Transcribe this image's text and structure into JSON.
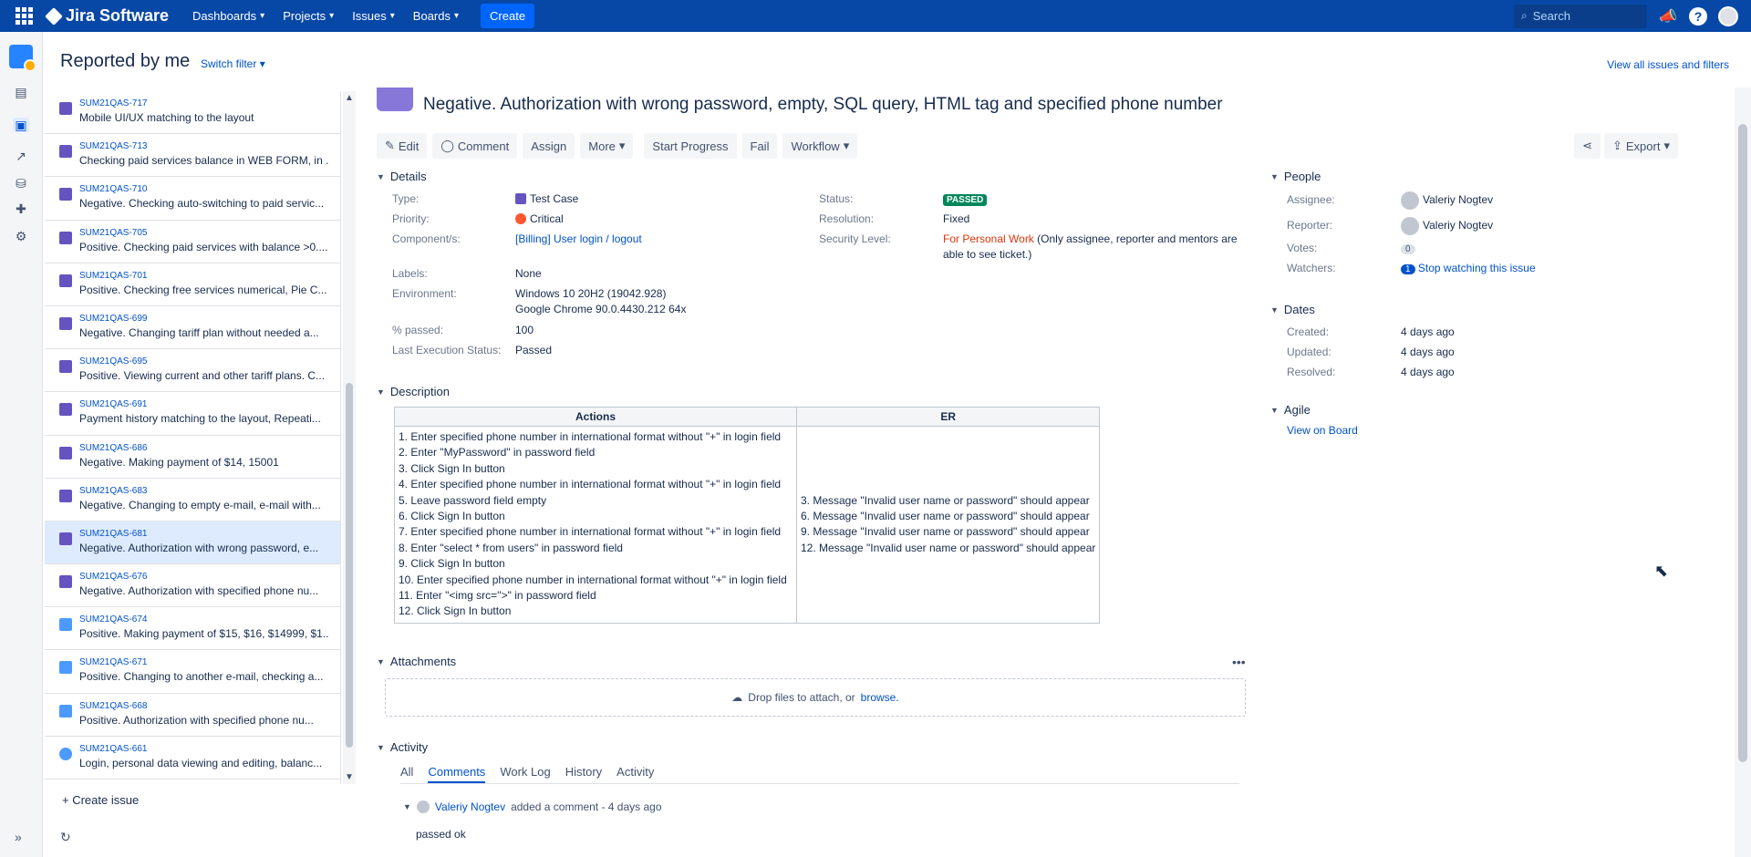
{
  "topnav": {
    "product": "Jira Software",
    "menu": [
      "Dashboards",
      "Projects",
      "Issues",
      "Boards"
    ],
    "create_label": "Create",
    "search_placeholder": "Search"
  },
  "header": {
    "title": "Reported by me",
    "switch_filter": "Switch filter",
    "view_all": "View all issues and filters"
  },
  "issues": [
    {
      "key": "SUM21QAS-717",
      "summary": "Mobile UI/UX matching to the layout",
      "type": "test"
    },
    {
      "key": "SUM21QAS-713",
      "summary": "Checking paid services balance in WEB FORM, in ...",
      "type": "test"
    },
    {
      "key": "SUM21QAS-710",
      "summary": "Negative. Checking auto-switching to paid servic...",
      "type": "test"
    },
    {
      "key": "SUM21QAS-705",
      "summary": "Positive. Checking paid services with balance >0....",
      "type": "test"
    },
    {
      "key": "SUM21QAS-701",
      "summary": "Positive. Checking free services numerical, Pie C...",
      "type": "test"
    },
    {
      "key": "SUM21QAS-699",
      "summary": "Negative. Changing tariff plan without needed a...",
      "type": "test"
    },
    {
      "key": "SUM21QAS-695",
      "summary": "Positive. Viewing current and other tariff plans. C...",
      "type": "test"
    },
    {
      "key": "SUM21QAS-691",
      "summary": "Payment history matching to the layout, Repeati...",
      "type": "test"
    },
    {
      "key": "SUM21QAS-686",
      "summary": "Negative. Making payment of $14, 15001",
      "type": "test"
    },
    {
      "key": "SUM21QAS-683",
      "summary": "Negative. Changing to empty e-mail, e-mail with...",
      "type": "test"
    },
    {
      "key": "SUM21QAS-681",
      "summary": "Negative. Authorization with wrong password, e...",
      "type": "test",
      "selected": true
    },
    {
      "key": "SUM21QAS-676",
      "summary": "Negative. Authorization with specified phone nu...",
      "type": "test"
    },
    {
      "key": "SUM21QAS-674",
      "summary": "Positive. Making payment of $15, $16, $14999, $1...",
      "type": "story"
    },
    {
      "key": "SUM21QAS-671",
      "summary": "Positive. Changing to another e-mail, checking a...",
      "type": "story"
    },
    {
      "key": "SUM21QAS-668",
      "summary": "Positive. Authorization with specified phone nu...",
      "type": "story"
    },
    {
      "key": "SUM21QAS-661",
      "summary": "Login, personal data viewing and editing, balanc...",
      "type": "epic"
    }
  ],
  "create_issue": "+ Create issue",
  "issue": {
    "title": "Negative. Authorization with wrong password, empty, SQL query, HTML tag and specified phone number",
    "toolbar": [
      "Edit",
      "Comment",
      "Assign",
      "More",
      "Start Progress",
      "Fail",
      "Workflow"
    ],
    "export_label": "Export",
    "details_heading": "Details",
    "fields": {
      "type_label": "Type:",
      "type": "Test Case",
      "priority_label": "Priority:",
      "priority": "Critical",
      "components_label": "Component/s:",
      "components": "[Billing] User login / logout",
      "labels_label": "Labels:",
      "labels": "None",
      "environment_label": "Environment:",
      "environment_1": "Windows 10 20H2 (19042.928)",
      "environment_2": "Google Chrome 90.0.4430.212 64x",
      "passed_label": "% passed:",
      "passed": "100",
      "last_exec_label": "Last Execution Status:",
      "last_exec": "Passed",
      "status_label": "Status:",
      "status": "PASSED",
      "resolution_label": "Resolution:",
      "resolution": "Fixed",
      "security_label": "Security Level:",
      "security_link": "For Personal Work",
      "security_note_1": "(Only assignee, reporter and mentors are",
      "security_note_2": "able to see ticket.)"
    },
    "description_heading": "Description",
    "table": {
      "headers": [
        "Actions",
        "ER"
      ],
      "actions": [
        "1. Enter specified phone number in international format without \"+\" in login field",
        "2. Enter \"MyPassword\" in password field",
        "3. Click Sign In button",
        "4. Enter specified phone number in international format without \"+\" in login field",
        "5. Leave password field empty",
        "6. Click Sign In button",
        "7. Enter specified phone number in international format without \"+\" in login field",
        "8. Enter \"select * from users\" in password field",
        "9. Click Sign In button",
        "10. Enter specified phone number in international format without \"+\" in login field",
        "11. Enter \"<img src=''>\" in password field",
        "12. Click Sign In button"
      ],
      "er": [
        "3. Message \"Invalid user name or password\" should appear",
        "6. Message \"Invalid user name or password\" should appear",
        "9. Message \"Invalid user name or password\" should appear",
        "12. Message \"Invalid user name or password\" should appear"
      ]
    },
    "attachments_heading": "Attachments",
    "drop_text": "Drop files to attach, or",
    "browse": "browse.",
    "activity_heading": "Activity",
    "activity_tabs": [
      "All",
      "Comments",
      "Work Log",
      "History",
      "Activity"
    ],
    "comment_author": "Valeriy Nogtev",
    "comment_meta": "added a comment - 4 days ago",
    "comment_body": "passed ok"
  },
  "people": {
    "heading": "People",
    "assignee_label": "Assignee:",
    "assignee": "Valeriy Nogtev",
    "reporter_label": "Reporter:",
    "reporter": "Valeriy Nogtev",
    "votes_label": "Votes:",
    "votes": "0",
    "watchers_label": "Watchers:",
    "watchers": "1",
    "stop_watching": "Stop watching this issue"
  },
  "dates": {
    "heading": "Dates",
    "created_label": "Created:",
    "created": "4 days ago",
    "updated_label": "Updated:",
    "updated": "4 days ago",
    "resolved_label": "Resolved:",
    "resolved": "4 days ago"
  },
  "agile": {
    "heading": "Agile",
    "view_on_board": "View on Board"
  },
  "colors": {
    "nav": "#0747A6",
    "link": "#0052CC",
    "passed": "#00875A",
    "critical": "#FF5630"
  }
}
